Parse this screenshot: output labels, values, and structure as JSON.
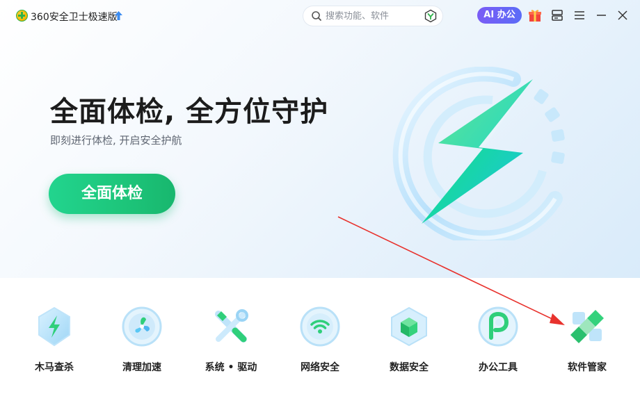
{
  "titlebar": {
    "app_title": "360安全卫士极速版",
    "search_placeholder": "搜索功能、软件",
    "ai_button_label": "AI 办公"
  },
  "hero": {
    "headline": "全面体检, 全方位守护",
    "subline": "即刻进行体检, 开启安全护航",
    "scan_button_label": "全面体检"
  },
  "tools": [
    {
      "label": "木马查杀",
      "icon": "trojan-scan-icon"
    },
    {
      "label": "清理加速",
      "icon": "cleanup-fan-icon"
    },
    {
      "label": "系统 • 驱动",
      "icon": "system-tools-icon"
    },
    {
      "label": "网络安全",
      "icon": "wifi-icon"
    },
    {
      "label": "数据安全",
      "icon": "data-cube-icon"
    },
    {
      "label": "办公工具",
      "icon": "office-p-icon"
    },
    {
      "label": "软件管家",
      "icon": "software-manager-icon"
    }
  ],
  "colors": {
    "accent_green": "#1dc57a",
    "ai_purple": "#7a5cf5",
    "annotation_red": "#e8322d"
  }
}
